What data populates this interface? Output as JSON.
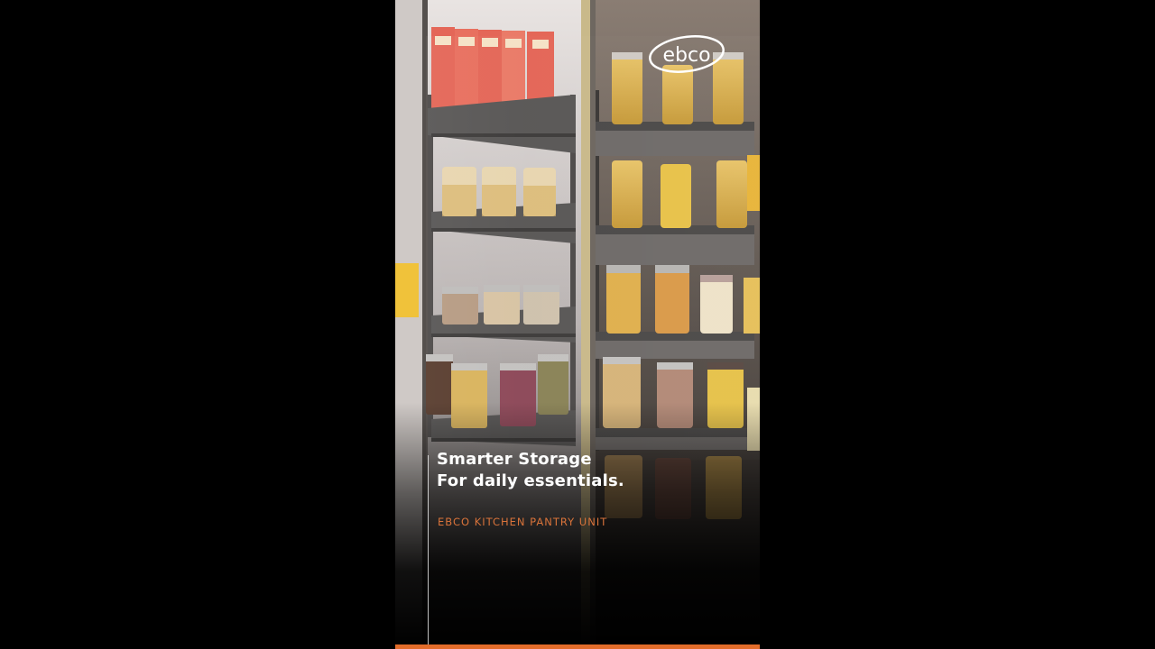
{
  "brand": {
    "logo_text": "ebco"
  },
  "overlay": {
    "headline_line1": "Smarter Storage",
    "headline_line2": "For daily essentials.",
    "subtitle": "EBCO KITCHEN PANTRY UNIT"
  },
  "playback": {
    "progress_fraction": 1.0
  },
  "colors": {
    "accent": "#e36c2a",
    "subtitle": "#d9733a",
    "letterbox": "#000000"
  }
}
